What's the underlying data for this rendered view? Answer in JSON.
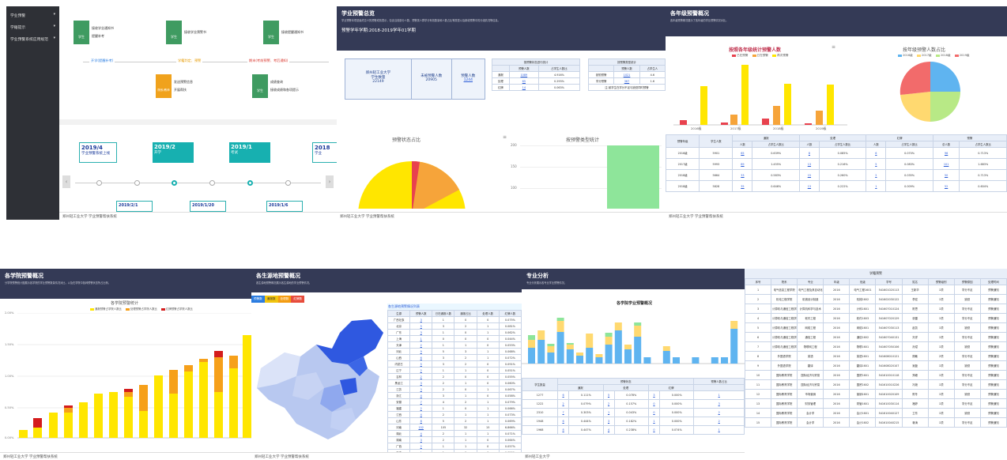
{
  "p1": {
    "sidebar": [
      "学业预警",
      "学籍提示",
      "学业预警系统应用规范"
    ],
    "flow": [
      {
        "role": "学生",
        "a": "接收学业通知书",
        "b": "提醒补考"
      },
      {
        "role": "学生",
        "a": "接收学业预警书"
      },
      {
        "role": "学生",
        "a": "接收提醒通知书"
      }
    ],
    "steps": [
      "开学(提醒补考)",
      "学籍判定、预警",
      "期末(考前预警、考后通知)"
    ],
    "flow2": [
      {
        "role": "院系/教师",
        "a": "发送预警信息",
        "b": "开展帮扶"
      },
      {
        "role": "学生",
        "a": "成绩查询",
        "b": "接收成绩和各项提示"
      }
    ],
    "timeline": [
      {
        "date": "2019/4",
        "label": "学业预警系统上线"
      },
      {
        "date": "2019/2",
        "label": "开学"
      },
      {
        "date": "2019/1",
        "label": "考试"
      },
      {
        "date": "2018",
        "label": "学业"
      }
    ],
    "below": [
      "2019/2/1",
      "2019/1/20",
      "2019/1/6"
    ],
    "footer": "郑州轻工业大学    学业预警帮扶系统"
  },
  "p2": {
    "title": "学业预警总览",
    "desc": "学业预警本项是最终意义的预警成效表示，包含当前部分人数、预警类人群学分有效数量和人数占比等类型以及新增预警中的分组情况等信息。",
    "term": "预警学年学期:2018-2019学年01学期",
    "school": "郑州轻工业大学",
    "school_sub": "学生数量",
    "school_n": "22149",
    "kh1": "未被预警人数",
    "kv1": "20905",
    "kh2": "预警人数",
    "kv2": "1244",
    "t1_title": "按预警状态进行统计",
    "t1_cols": [
      "",
      "预警人数",
      "占学生人数比"
    ],
    "t1_rows": [
      [
        "通报",
        "1089",
        "4.916%"
      ],
      [
        "处理",
        "65",
        "0.293%"
      ],
      [
        "红牌",
        "14",
        "0.063%"
      ]
    ],
    "t2_title": "按预警类型统计",
    "t2_cols": [
      "",
      "预警人数",
      "占学生人"
    ],
    "t2_rows": [
      [
        "缺勤预警",
        "1021",
        "4.6"
      ],
      [
        "学分预警",
        "367",
        "1.6"
      ]
    ],
    "t2_note": "注:某学生在学分不足与缺勤同时预警",
    "pie_title": "预警状态占比",
    "bar_title": "按预警类型统计",
    "bar_ticks": [
      "200",
      "150",
      "100"
    ],
    "footer": "郑州轻工业大学    学业预警帮扶系统"
  },
  "p3": {
    "title": "各年级预警概况",
    "desc": "各年级预警概况展示了各年级的学业预警情况对比。",
    "bar_title": "按照各年级统计预警人数",
    "bar_legend": [
      "已在预警",
      "已在预警",
      "再次预警"
    ],
    "bar_cats": [
      "2016级",
      "2017级",
      "2018级",
      "2019级"
    ],
    "pie_title": "按年级预警人数占比",
    "pie_legend": [
      "2016级",
      "2017级",
      "2018级",
      "2019级"
    ],
    "cols": [
      "预警年级",
      "学生人数",
      "通报",
      "",
      "处理",
      "",
      "红牌",
      "",
      "预警",
      ""
    ],
    "sub": [
      "人数",
      "占学生人数比",
      "人数",
      "占学生人数比",
      "人数",
      "占学生人数比",
      "总人数",
      "占学生人数比"
    ],
    "rows": [
      [
        "2016级",
        "5901",
        "65",
        "0.639%",
        "8",
        "0.085%",
        "6",
        "0.070%",
        "96",
        "0.713%"
      ],
      [
        "2017级",
        "5993",
        "89",
        "1.455%",
        "13",
        "0.216%",
        "5",
        "0.083%",
        "101",
        "1.683%"
      ],
      [
        "2018级",
        "5664",
        "33",
        "0.583%",
        "15",
        "0.260%",
        "2",
        "0.035%",
        "50",
        "0.713%"
      ],
      [
        "2018级",
        "5828",
        "35",
        "0.646%",
        "13",
        "0.222%",
        "1",
        "0.009%",
        "52",
        "0.604%"
      ]
    ],
    "footer": "郑州轻工业大学    学业预警帮扶系统"
  },
  "p4": {
    "title": "各学院预警概况",
    "desc": "分学院预警统计图展示各学院的学业预警数量情况对比，以及在学院中各种预警状态所占比例。",
    "chart_title": "各学院预警统计",
    "legend": [
      "通报预警占学院人数比",
      "处理预警占学院人数比",
      "红牌预警占学院人数比"
    ],
    "yticks": [
      "2.00%",
      "1.50%",
      "1.00%",
      "0.50%",
      "0.00%"
    ],
    "footer": "郑州轻工业大学    学业预警帮扶系统"
  },
  "p5": {
    "title": "各生源地预警概况",
    "desc": "各生源地预警概况展示各生源地的学业预警情况。",
    "tabs": [
      "预警数",
      "通报数",
      "处理数",
      "红牌数"
    ],
    "table_title": "各生源地预警情况列表",
    "cols": [
      "生源",
      "预警人数",
      "已在通报人数",
      "通报占比",
      "处理人数",
      "红牌人数"
    ],
    "rows": [
      [
        "广西壮族",
        "3",
        "1",
        "0",
        "0",
        "0.075%"
      ],
      [
        "北京",
        "5",
        "3",
        "2",
        "1",
        "0.081%"
      ],
      [
        "广东",
        "3",
        "1",
        "0",
        "1",
        "0.062%"
      ],
      [
        "上海",
        "1",
        "0",
        "0",
        "0",
        "0.044%"
      ],
      [
        "天津",
        "2",
        "1",
        "1",
        "0",
        "0.053%"
      ],
      [
        "河北",
        "9",
        "5",
        "3",
        "1",
        "0.068%"
      ],
      [
        "山西",
        "6",
        "3",
        "2",
        "1",
        "0.072%"
      ],
      [
        "内蒙古",
        "5",
        "3",
        "2",
        "0",
        "0.091%"
      ],
      [
        "辽宁",
        "2",
        "1",
        "1",
        "0",
        "0.051%"
      ],
      [
        "吉林",
        "2",
        "2",
        "0",
        "0",
        "0.055%"
      ],
      [
        "黑龙江",
        "3",
        "2",
        "1",
        "0",
        "0.060%"
      ],
      [
        "江苏",
        "3",
        "2",
        "0",
        "1",
        "0.067%"
      ],
      [
        "浙江",
        "4",
        "3",
        "1",
        "0",
        "0.058%"
      ],
      [
        "安徽",
        "7",
        "4",
        "2",
        "1",
        "0.079%"
      ],
      [
        "福建",
        "2",
        "1",
        "0",
        "1",
        "0.066%"
      ],
      [
        "江西",
        "4",
        "2",
        "1",
        "1",
        "0.073%"
      ],
      [
        "山东",
        "8",
        "5",
        "2",
        "1",
        "0.069%"
      ],
      [
        "河南",
        "152",
        "105",
        "32",
        "15",
        "6.866%"
      ],
      [
        "湖北",
        "4",
        "2",
        "1",
        "1",
        "0.071%"
      ],
      [
        "湖南",
        "3",
        "2",
        "1",
        "0",
        "0.064%"
      ],
      [
        "广西",
        "2",
        "1",
        "1",
        "0",
        "0.057%"
      ],
      [
        "海南",
        "1",
        "1",
        "0",
        "0",
        "0.050%"
      ],
      [
        "重庆",
        "3",
        "2",
        "1",
        "0",
        "0.063%"
      ],
      [
        "四川",
        "5",
        "3",
        "1",
        "1",
        "0.075%"
      ],
      [
        "贵州",
        "4",
        "2",
        "1",
        "1",
        "0.070%"
      ],
      [
        "云南",
        "3",
        "2",
        "1",
        "0",
        "0.059%"
      ]
    ],
    "footer": "郑州轻工业大学    学业预警帮扶系统"
  },
  "p6": {
    "title": "专业分析",
    "desc": "专业分析展示各专业学业预警情况。",
    "chart_title": "各学院学业预警概况",
    "col_a": "学生数量",
    "col_b": "预警状态",
    "col_c": "预警人数占比",
    "sub": [
      "通报",
      "处理",
      "红牌"
    ],
    "rows": [
      [
        "1277",
        "6",
        "0.111%",
        "5",
        "0.078%",
        "3",
        "0.000%",
        "1"
      ],
      [
        "1222",
        "2",
        "0.079%",
        "2",
        "0.157%",
        "0",
        "0.000%",
        "3"
      ],
      [
        "2310",
        "7",
        "0.303%",
        "1",
        "0.043%",
        "0",
        "0.000%",
        "2"
      ],
      [
        "1948",
        "6",
        "0.444%",
        "3",
        "0.182%",
        "1",
        "0.000%",
        "2"
      ],
      [
        "1968",
        "8",
        "0.447%",
        "4",
        "0.238%",
        "0",
        "0.074%",
        "1"
      ]
    ],
    "footer": "郑州轻工业大学"
  },
  "p7": {
    "title": "学籍预警",
    "cols": [
      "序号",
      "院系",
      "专业",
      "年级",
      "班级",
      "学号",
      "姓名",
      "预警级别",
      "预警原因",
      "处理时间"
    ],
    "rows": [
      [
        "1",
        "电气信息工程学院",
        "电气工程及其自动化",
        "2016",
        "电气工程1601",
        "541601020113",
        "王新华",
        "1项",
        "学分不足",
        "预警通知"
      ],
      [
        "2",
        "机电工程学院",
        "机械设计制造",
        "2016",
        "机械1602",
        "541602030122",
        "李宏",
        "1项",
        "缺勤",
        "预警通知"
      ],
      [
        "3",
        "计算机与通信工程学院",
        "计算机科学与技术",
        "2016",
        "计科1601",
        "541607010124",
        "陈思",
        "1项",
        "学分不足",
        "预警通知"
      ],
      [
        "4",
        "计算机与通信工程学院",
        "软件工程",
        "2016",
        "软件1603",
        "541607020129",
        "张雷",
        "1项",
        "学分不足",
        "预警通知"
      ],
      [
        "5",
        "计算机与通信工程学院",
        "网络工程",
        "2016",
        "网络1601",
        "541607030113",
        "赵凯",
        "1项",
        "缺勤",
        "预警通知"
      ],
      [
        "6",
        "计算机与通信工程学院",
        "通信工程",
        "2016",
        "通信1602",
        "541607040131",
        "刘洋",
        "1项",
        "学分不足",
        "预警通知"
      ],
      [
        "7",
        "计算机与通信工程学院",
        "物联网工程",
        "2016",
        "物联1601",
        "541607050106",
        "孙斌",
        "1项",
        "缺勤",
        "预警通知"
      ],
      [
        "8",
        "外国语学院",
        "英语",
        "2016",
        "英语1601",
        "541608010121",
        "周敏",
        "2项",
        "学分不足",
        "预警通知"
      ],
      [
        "9",
        "外国语学院",
        "翻译",
        "2016",
        "翻译1601",
        "541608020107",
        "吴磊",
        "1项",
        "缺勤",
        "预警通知"
      ],
      [
        "10",
        "国际教育学院",
        "国际经济与贸易",
        "2016",
        "国贸1601",
        "541610010118",
        "郑峰",
        "1项",
        "学分不足",
        "预警通知"
      ],
      [
        "11",
        "国际教育学院",
        "国际经济与贸易",
        "2016",
        "国贸1602",
        "541610010226",
        "冯艳",
        "1项",
        "学分不足",
        "预警通知"
      ],
      [
        "12",
        "国际教育学院",
        "市场营销",
        "2016",
        "营销1601",
        "541610020109",
        "陈冬",
        "1项",
        "缺勤",
        "预警通知"
      ],
      [
        "13",
        "国际教育学院",
        "财务管理",
        "2016",
        "财管1601",
        "541610030114",
        "褚婷",
        "1项",
        "学分不足",
        "预警通知"
      ],
      [
        "14",
        "国际教育学院",
        "会计学",
        "2016",
        "会计1601",
        "541610040127",
        "卫东",
        "1项",
        "缺勤",
        "预警通知"
      ],
      [
        "15",
        "国际教育学院",
        "会计学",
        "2016",
        "会计1602",
        "541610040215",
        "蒋涛",
        "1项",
        "学分不足",
        "预警通知"
      ]
    ]
  }
}
